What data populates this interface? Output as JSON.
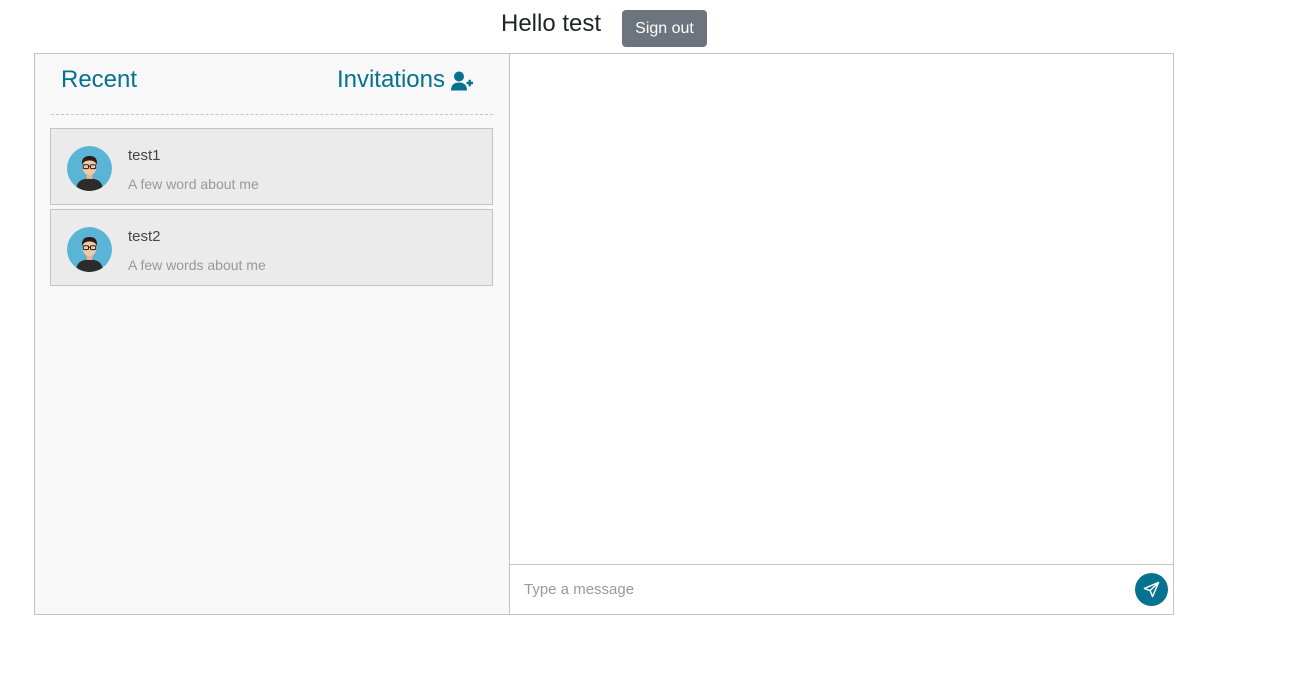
{
  "header": {
    "greeting": "Hello test",
    "signout_label": "Sign out"
  },
  "sidebar": {
    "tabs": {
      "recent": "Recent",
      "invitations": "Invitations"
    },
    "chats": [
      {
        "name": "test1",
        "description": "A few word about me",
        "avatar_icon": "user-avatar-icon"
      },
      {
        "name": "test2",
        "description": "A few words about me",
        "avatar_icon": "user-avatar-icon"
      }
    ]
  },
  "composer": {
    "placeholder": "Type a message",
    "value": "",
    "send_icon": "paper-plane-icon"
  },
  "colors": {
    "accent": "#05728f",
    "signout_bg": "#6c757d",
    "sidebar_bg": "#f8f8f8",
    "chat_item_bg": "#ebebeb",
    "border": "#c4c4c4",
    "avatar_bg": "#5ab4d6"
  }
}
